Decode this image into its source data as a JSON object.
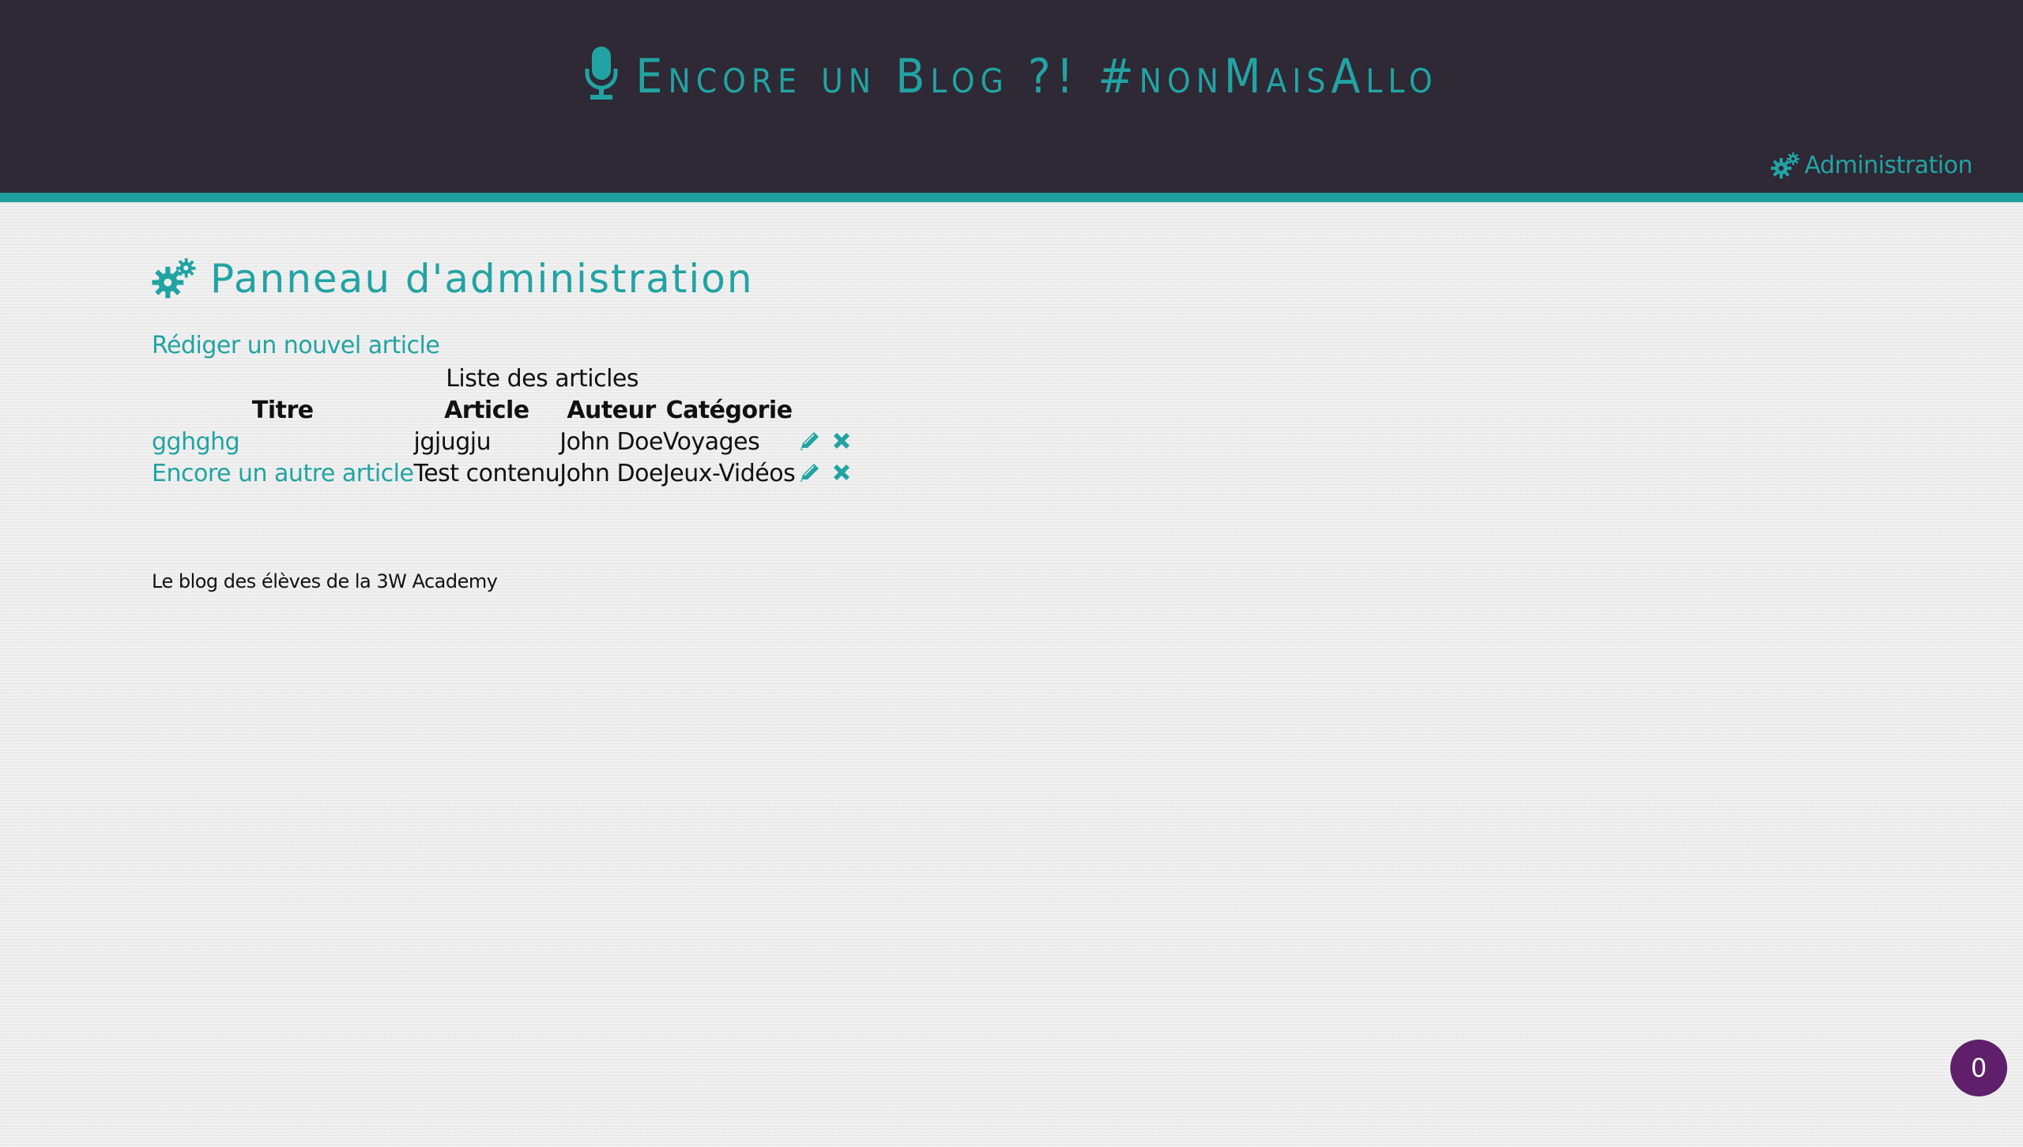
{
  "header": {
    "site_title": "Encore un Blog ?! #nonMaisAllo",
    "title_icon": "microphone-icon",
    "nav": {
      "admin_label": "Administration",
      "admin_icon": "gears-icon"
    }
  },
  "main": {
    "panel_title": "Panneau d'administration",
    "panel_icon": "gears-icon",
    "new_article_label": "Rédiger un nouvel article",
    "table": {
      "caption": "Liste des articles",
      "columns": [
        "Titre",
        "Article",
        "Auteur",
        "Catégorie"
      ],
      "rows": [
        {
          "title": "gghghg",
          "article": "jgjugju",
          "author": "John Doe",
          "category": "Voyages"
        },
        {
          "title": "Encore un autre article",
          "article": "Test contenu",
          "author": "John Doe",
          "category": "Jeux-Vidéos"
        }
      ],
      "row_actions": [
        "edit-icon",
        "delete-icon"
      ]
    }
  },
  "footer": {
    "text": "Le blog des élèves de la 3W Academy"
  },
  "badge": {
    "count": "0"
  },
  "colors": {
    "header_bg": "#2e2935",
    "accent": "#22a3a3",
    "badge_bg": "#5f1f6a",
    "page_bg": "#efefef"
  }
}
